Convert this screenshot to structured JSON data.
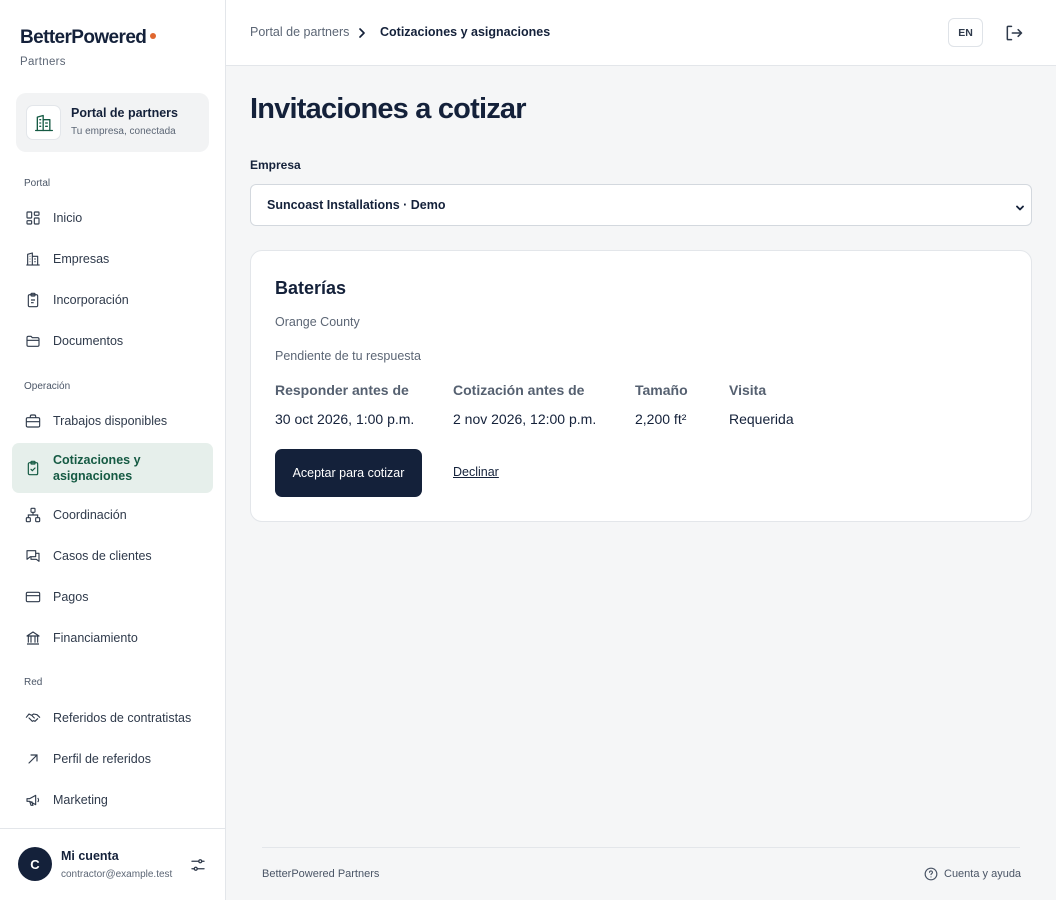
{
  "brand": {
    "name": "BetterPowered",
    "sub": "Partners",
    "accent_color": "#e0672f"
  },
  "portal_card": {
    "title": "Portal de partners",
    "subtitle": "Tu empresa, conectada",
    "icon": "building-icon"
  },
  "sidebar": {
    "sections": [
      {
        "label": "Portal",
        "items": [
          {
            "label": "Inicio",
            "icon": "dashboard-icon"
          },
          {
            "label": "Empresas",
            "icon": "building-icon"
          },
          {
            "label": "Incorporación",
            "icon": "clipboard-icon"
          },
          {
            "label": "Documentos",
            "icon": "folder-icon"
          }
        ]
      },
      {
        "label": "Operación",
        "items": [
          {
            "label": "Trabajos disponibles",
            "icon": "briefcase-icon"
          },
          {
            "label": "Cotizaciones y asignaciones",
            "icon": "clipboard-check-icon",
            "active": true
          },
          {
            "label": "Coordinación",
            "icon": "network-icon"
          },
          {
            "label": "Casos de clientes",
            "icon": "chat-icon"
          },
          {
            "label": "Pagos",
            "icon": "credit-card-icon"
          },
          {
            "label": "Financiamiento",
            "icon": "bank-icon"
          }
        ]
      },
      {
        "label": "Red",
        "items": [
          {
            "label": "Referidos de contratistas",
            "icon": "handshake-icon"
          },
          {
            "label": "Perfil de referidos",
            "icon": "arrow-up-right-icon"
          },
          {
            "label": "Marketing",
            "icon": "megaphone-icon"
          }
        ]
      }
    ]
  },
  "account": {
    "initial": "C",
    "name": "Mi cuenta",
    "email": "contractor@example.test"
  },
  "topbar": {
    "breadcrumb": [
      "Portal de partners",
      "Cotizaciones y asignaciones"
    ],
    "lang": "EN"
  },
  "main": {
    "title": "Invitaciones a cotizar",
    "company_label": "Empresa",
    "company_selected": "Suncoast Installations · Demo",
    "card": {
      "title": "Baterías",
      "location": "Orange County",
      "status": "Pendiente de tu respuesta",
      "meta": [
        {
          "label": "Responder antes de",
          "value": "30 oct 2026, 1:00 p.m."
        },
        {
          "label": "Cotización antes de",
          "value": "2 nov 2026, 12:00 p.m."
        },
        {
          "label": "Tamaño",
          "value": "2,200 ft²"
        },
        {
          "label": "Visita",
          "value": "Requerida"
        }
      ],
      "accept_label": "Aceptar para cotizar",
      "decline_label": "Declinar"
    }
  },
  "footer": {
    "brand": "BetterPowered Partners",
    "help": "Cuenta y ayuda"
  },
  "colors": {
    "navy": "#14213a",
    "active_bg": "#e6efeb",
    "active_text": "#155a43"
  }
}
